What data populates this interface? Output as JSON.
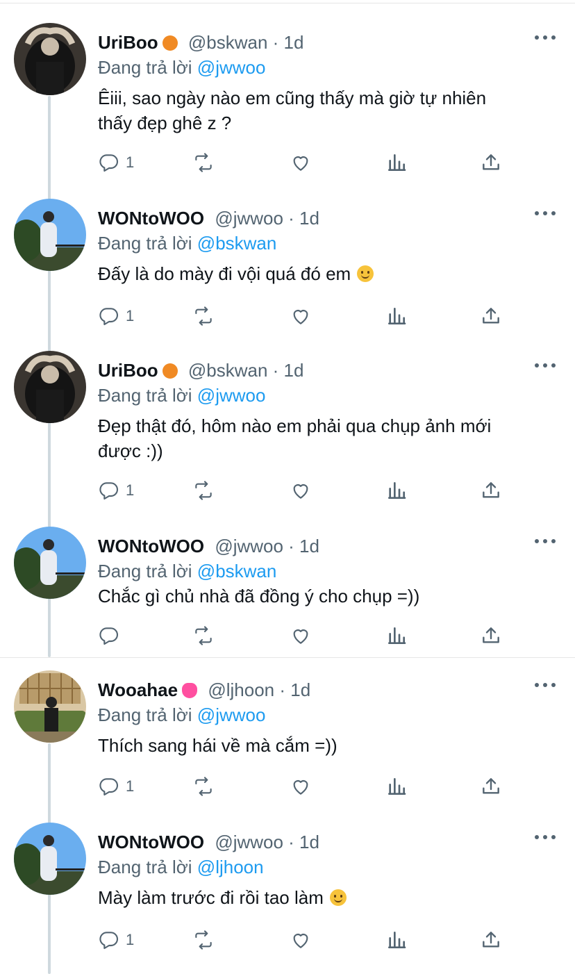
{
  "tweets": [
    {
      "name": "UriBoo",
      "badge_color": "#f08a24",
      "handle": "@bskwan · 1d",
      "reply_prefix": "Đang trả lời",
      "reply_to": "@jwwoo",
      "lines": [
        "Êiii, sao ngày nào em cũng thấy mà giờ tự nhiên",
        "thấy đẹp ghê z ?"
      ],
      "reply_count": "1",
      "avatar": "dark-hands"
    },
    {
      "name": "WONtoWOO",
      "handle": "@jwwoo · 1d",
      "reply_prefix": "Đang trả lời",
      "reply_to": "@bskwan",
      "lines": [
        "Đấy là do mày đi vội quá đó em"
      ],
      "reply_count": "1",
      "avatar": "blue-sky"
    },
    {
      "name": "UriBoo",
      "badge_color": "#f08a24",
      "handle": "@bskwan · 1d",
      "reply_prefix": "Đang trả lời",
      "reply_to": "@jwwoo",
      "lines": [
        "Đẹp thật đó, hôm nào em phải qua chụp ảnh mới",
        "được :))"
      ],
      "reply_count": "1",
      "avatar": "dark-hands"
    },
    {
      "name": "WONtoWOO",
      "handle": "@jwwoo · 1d",
      "reply_prefix": "Đang trả lời",
      "reply_to": "@bskwan",
      "lines": [
        "Chắc gì chủ nhà đã đồng ý cho chụp =))"
      ],
      "reply_count": "",
      "avatar": "blue-sky"
    },
    {
      "name": "Wooahae",
      "badge_color": "#ff4fa0",
      "handle": "@ljhoon · 1d",
      "reply_prefix": "Đang trả lời",
      "reply_to": "@jwwoo",
      "lines": [
        "Thích sang hái về mà cắm =))"
      ],
      "reply_count": "1",
      "avatar": "green-sofa"
    },
    {
      "name": "WONtoWOO",
      "handle": "@jwwoo · 1d",
      "reply_prefix": "Đang trả lời",
      "reply_to": "@ljhoon",
      "lines": [
        "Mày làm trước đi rồi tao làm"
      ],
      "reply_count": "1",
      "avatar": "blue-sky"
    }
  ],
  "colors": {
    "link": "#1d9bf0",
    "secondary_text": "#536471",
    "thread_line": "#cfd9de"
  },
  "icons": [
    "reply-icon",
    "retweet-icon",
    "like-icon",
    "analytics-icon",
    "share-icon",
    "more-icon"
  ]
}
